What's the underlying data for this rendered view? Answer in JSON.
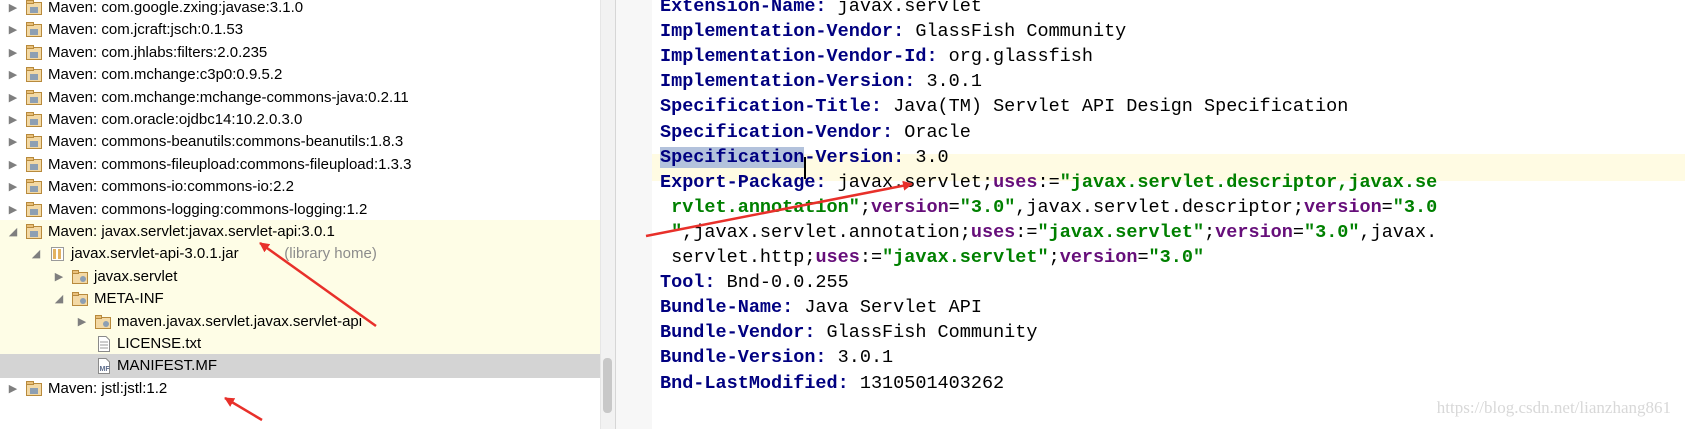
{
  "tree": {
    "rows": [
      {
        "label": "Maven: com.google.zxing:javase:3.1.0",
        "depth": 0,
        "icon": "library-icon",
        "arrow": "collapsed"
      },
      {
        "label": "Maven: com.jcraft:jsch:0.1.53",
        "depth": 0,
        "icon": "library-icon",
        "arrow": "collapsed"
      },
      {
        "label": "Maven: com.jhlabs:filters:2.0.235",
        "depth": 0,
        "icon": "library-icon",
        "arrow": "collapsed"
      },
      {
        "label": "Maven: com.mchange:c3p0:0.9.5.2",
        "depth": 0,
        "icon": "library-icon",
        "arrow": "collapsed"
      },
      {
        "label": "Maven: com.mchange:mchange-commons-java:0.2.11",
        "depth": 0,
        "icon": "library-icon",
        "arrow": "collapsed"
      },
      {
        "label": "Maven: com.oracle:ojdbc14:10.2.0.3.0",
        "depth": 0,
        "icon": "library-icon",
        "arrow": "collapsed"
      },
      {
        "label": "Maven: commons-beanutils:commons-beanutils:1.8.3",
        "depth": 0,
        "icon": "library-icon",
        "arrow": "collapsed"
      },
      {
        "label": "Maven: commons-fileupload:commons-fileupload:1.3.3",
        "depth": 0,
        "icon": "library-icon",
        "arrow": "collapsed"
      },
      {
        "label": "Maven: commons-io:commons-io:2.2",
        "depth": 0,
        "icon": "library-icon",
        "arrow": "collapsed"
      },
      {
        "label": "Maven: commons-logging:commons-logging:1.2",
        "depth": 0,
        "icon": "library-icon",
        "arrow": "collapsed"
      },
      {
        "label": "Maven: javax.servlet:javax.servlet-api:3.0.1",
        "depth": 0,
        "icon": "library-icon",
        "arrow": "expanded",
        "highlight": "lib"
      },
      {
        "label": "javax.servlet-api-3.0.1.jar",
        "hint": " (library home)",
        "depth": 1,
        "icon": "jar-icon",
        "arrow": "expanded",
        "highlight": "lib"
      },
      {
        "label": "javax.servlet",
        "depth": 2,
        "icon": "package-icon",
        "arrow": "collapsed",
        "highlight": "lib"
      },
      {
        "label": "META-INF",
        "depth": 2,
        "icon": "package-icon",
        "arrow": "expanded",
        "highlight": "lib"
      },
      {
        "label": "maven.javax.servlet.javax.servlet-api",
        "depth": 3,
        "icon": "package-icon",
        "arrow": "collapsed",
        "highlight": "lib"
      },
      {
        "label": "LICENSE.txt",
        "depth": 3,
        "icon": "text-file-icon",
        "arrow": "none",
        "highlight": "lib"
      },
      {
        "label": "MANIFEST.MF",
        "depth": 3,
        "icon": "manifest-file-icon",
        "arrow": "none",
        "highlight": "selected"
      },
      {
        "label": "Maven: jstl:jstl:1.2",
        "depth": 0,
        "icon": "library-icon",
        "arrow": "collapsed"
      }
    ]
  },
  "editor": {
    "lines": [
      [
        {
          "t": "Extension-Name:",
          "c": "k"
        },
        {
          "t": " javax.servlet"
        }
      ],
      [
        {
          "t": "Implementation-Vendor:",
          "c": "k"
        },
        {
          "t": " GlassFish Community"
        }
      ],
      [
        {
          "t": "Implementation-Vendor-Id:",
          "c": "k"
        },
        {
          "t": " org.glassfish"
        }
      ],
      [
        {
          "t": "Implementation-Version:",
          "c": "k"
        },
        {
          "t": " 3.0.1"
        }
      ],
      [
        {
          "t": "Specification-Title:",
          "c": "k"
        },
        {
          "t": " Java(TM) Servlet API Design Specification"
        }
      ],
      [
        {
          "t": "Specification-Vendor:",
          "c": "k"
        },
        {
          "t": " Oracle"
        }
      ],
      [
        {
          "t": "Specification",
          "c": "k sel-k"
        },
        {
          "t": "-Version:",
          "c": "k"
        },
        {
          "t": " 3.0"
        }
      ],
      [
        {
          "t": "Export-Package:",
          "c": "k"
        },
        {
          "t": " javax.servlet;"
        },
        {
          "t": "uses",
          "c": "kw"
        },
        {
          "t": ":="
        },
        {
          "t": "\"javax.servlet.descriptor,javax.se",
          "c": "st"
        }
      ],
      [
        {
          "t": " "
        },
        {
          "t": "rvlet.annotation\"",
          "c": "st"
        },
        {
          "t": ";"
        },
        {
          "t": "version",
          "c": "kw"
        },
        {
          "t": "="
        },
        {
          "t": "\"3.0\"",
          "c": "st"
        },
        {
          "t": ",javax.servlet.descriptor;"
        },
        {
          "t": "version",
          "c": "kw"
        },
        {
          "t": "="
        },
        {
          "t": "\"3.0",
          "c": "st"
        }
      ],
      [
        {
          "t": " "
        },
        {
          "t": "\"",
          "c": "st"
        },
        {
          "t": ",javax.servlet.annotation;"
        },
        {
          "t": "uses",
          "c": "kw"
        },
        {
          "t": ":="
        },
        {
          "t": "\"javax.servlet\"",
          "c": "st"
        },
        {
          "t": ";"
        },
        {
          "t": "version",
          "c": "kw"
        },
        {
          "t": "="
        },
        {
          "t": "\"3.0\"",
          "c": "st"
        },
        {
          "t": ",javax."
        }
      ],
      [
        {
          "t": " servlet.http;"
        },
        {
          "t": "uses",
          "c": "kw"
        },
        {
          "t": ":="
        },
        {
          "t": "\"javax.servlet\"",
          "c": "st"
        },
        {
          "t": ";"
        },
        {
          "t": "version",
          "c": "kw"
        },
        {
          "t": "="
        },
        {
          "t": "\"3.0\"",
          "c": "st"
        }
      ],
      [
        {
          "t": "Tool:",
          "c": "k"
        },
        {
          "t": " Bnd-0.0.255"
        }
      ],
      [
        {
          "t": "Bundle-Name:",
          "c": "k"
        },
        {
          "t": " Java Servlet API"
        }
      ],
      [
        {
          "t": "Bundle-Vendor:",
          "c": "k"
        },
        {
          "t": " GlassFish Community"
        }
      ],
      [
        {
          "t": "Bundle-Version:",
          "c": "k"
        },
        {
          "t": " 3.0.1"
        }
      ],
      [
        {
          "t": "Bnd-LastModified:",
          "c": "k"
        },
        {
          "t": " 1310501403262"
        }
      ]
    ]
  },
  "watermark": "https://blog.csdn.net/lianzhang861",
  "colors": {
    "key": "#000080",
    "keyword": "#660e7a",
    "string": "#008000",
    "annotation_arrow": "#e8302a",
    "library_highlight": "#fefde6",
    "selected_row": "#d4d4d4"
  }
}
